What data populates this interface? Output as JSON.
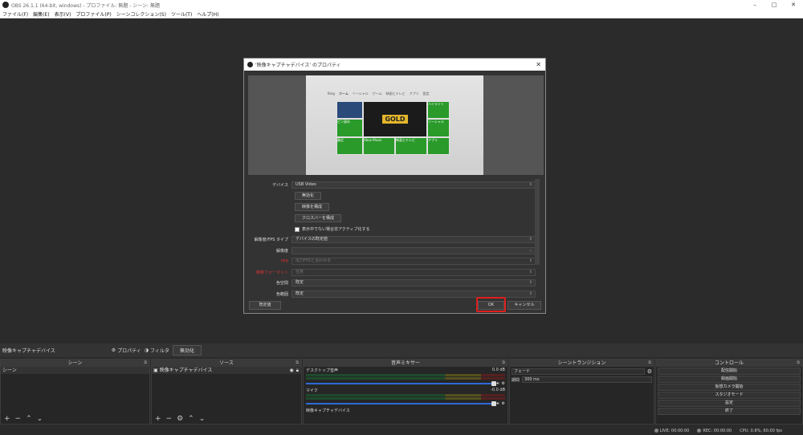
{
  "window": {
    "title": "OBS 26.1.1 (64-bit, windows) - プロファイル: 無題 - シーン: 無題",
    "controls": [
      "–",
      "□",
      "✕"
    ]
  },
  "menu": [
    "ファイル(F)",
    "編集(E)",
    "表示(V)",
    "プロファイル(P)",
    "シーンコレクション(S)",
    "ツール(T)",
    "ヘルプ(H)"
  ],
  "dialog": {
    "title": "'映像キャプチャデバイス' のプロパティ",
    "preview": {
      "nav": [
        "Bing",
        "ホーム",
        "ソーシャル",
        "ゲーム",
        "映画とテレビ",
        "アプリ",
        "設定"
      ],
      "gold": "GOLD",
      "tiles": [
        "ハイライト",
        "ソーシャル",
        "ゲーム",
        "映画とテレビ",
        "ピン留め",
        "最近",
        "Xbox Music",
        "アプリ"
      ]
    },
    "props": {
      "device_label": "デバイス",
      "device_value": "USB Video",
      "deactivate": "無効化",
      "config_video": "映像を構成",
      "config_crossbar": "クロスバーを構成",
      "deactivate_checkbox": "表示中でない場合非アクティブ化する",
      "res_type_label": "解像度/FPS タイプ",
      "res_type_value": "デバイスの既定値",
      "res_label": "解像度",
      "res_value": "",
      "fps_label": "FPS",
      "fps_value": "出力FPSと合わせる",
      "format_label": "映像フォーマット",
      "format_value": "任意",
      "colorspace_label": "色空間",
      "colorspace_value": "既定",
      "colorrange_label": "色範囲",
      "colorrange_value": "既定"
    },
    "defaults": "既定値",
    "ok": "OK",
    "cancel": "キャンセル"
  },
  "sourcebar": {
    "name": "映像キャプチャデバイス",
    "properties": "プロパティ",
    "filters": "フィルタ",
    "deactivate": "無効化"
  },
  "panels": {
    "scenes": {
      "title": "シーン",
      "items": [
        "シーン"
      ]
    },
    "sources": {
      "title": "ソース",
      "items": [
        "映像キャプチャデバイス"
      ]
    },
    "mixer": {
      "title": "音声ミキサー",
      "channels": [
        {
          "name": "デスクトップ音声",
          "db": "0.0 dB"
        },
        {
          "name": "マイク",
          "db": "-0.0 dB"
        },
        {
          "name": "映像キャプチャデバイス",
          "db": ""
        }
      ]
    },
    "transitions": {
      "title": "シーントランジション",
      "type": "フェード",
      "duration_label": "期間",
      "duration_value": "300 ms"
    },
    "controls": {
      "title": "コントロール",
      "buttons": [
        "配信開始",
        "録画開始",
        "仮想カメラ開始",
        "スタジオモード",
        "設定",
        "終了"
      ]
    }
  },
  "status": {
    "live": "LIVE: 00:00:00",
    "rec": "REC: 00:00:00",
    "cpu": "CPU: 0.8%, 60.00 fps"
  }
}
